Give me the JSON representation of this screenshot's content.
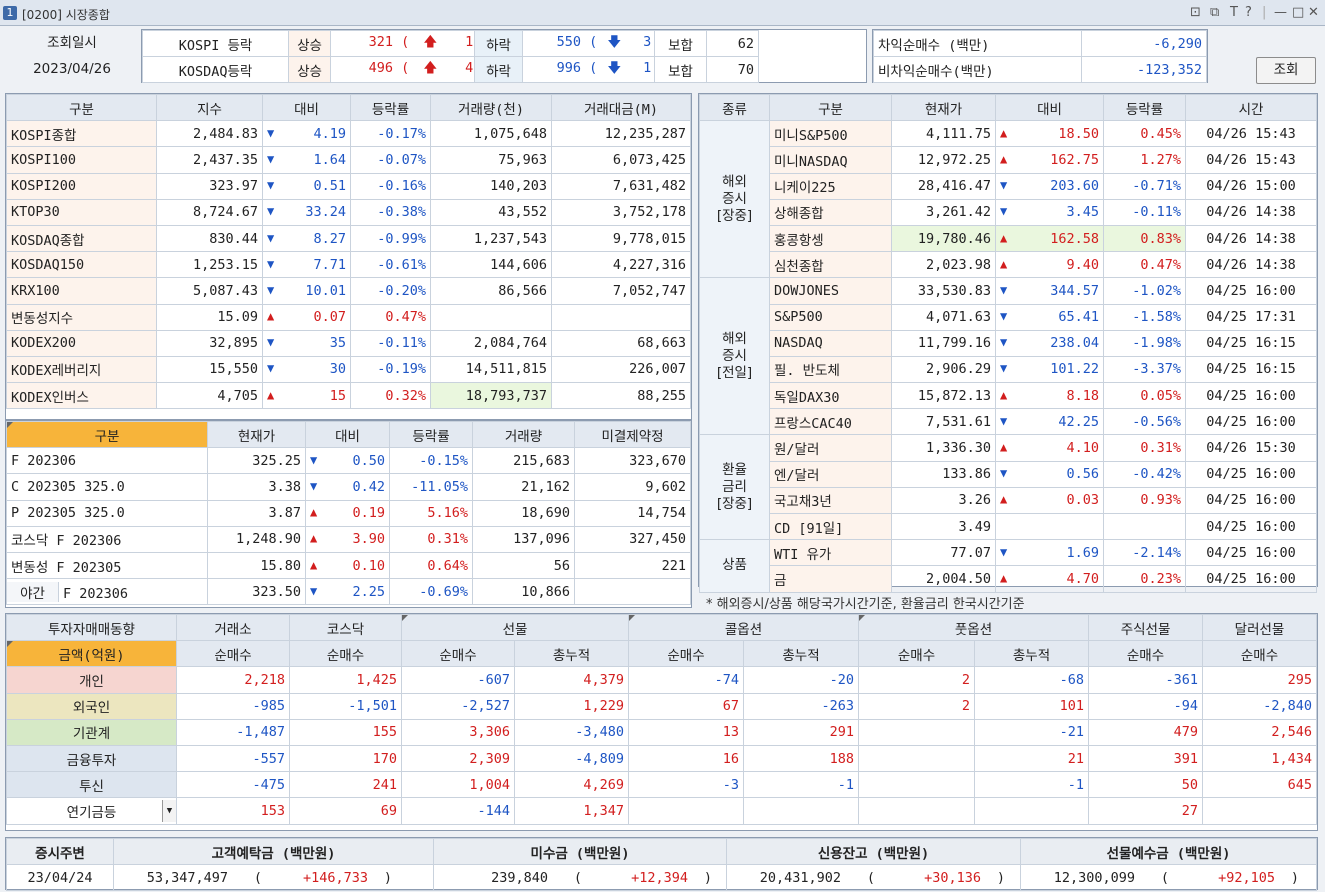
{
  "title": {
    "screen_num": "1",
    "text": "[0200] 시장종합",
    "icons": [
      "layout-icon",
      "window-icon",
      "text-icon",
      "help-icon",
      "minimize-icon",
      "maximize-icon",
      "close-icon"
    ]
  },
  "summary": {
    "query_label": "조회일시",
    "query_date": "2023/04/26",
    "rows": [
      {
        "name": "KOSPI 등락",
        "up_label": "상승",
        "up": "321",
        "up_limit": "1",
        "down_label": "하락",
        "down": "550",
        "down_limit": "3",
        "flat_label": "보합",
        "flat": "62"
      },
      {
        "name": "KOSDAQ등락",
        "up_label": "상승",
        "up": "496",
        "up_limit": "4",
        "down_label": "하락",
        "down": "996",
        "down_limit": "1",
        "flat_label": "보합",
        "flat": "70"
      }
    ],
    "program": [
      {
        "label": "차익순매수  (백만)",
        "value": "-6,290"
      },
      {
        "label": "비차익순매수(백만)",
        "value": "-123,352"
      }
    ],
    "button": "조회"
  },
  "index_table": {
    "headers": [
      "구분",
      "지수",
      "대비",
      "등락률",
      "거래량(천)",
      "거래대금(M)"
    ],
    "rows": [
      [
        "KOSPI종합",
        "2,484.83",
        "dn",
        "4.19",
        "-0.17%",
        "1,075,648",
        "12,235,287"
      ],
      [
        "KOSPI100",
        "2,437.35",
        "dn",
        "1.64",
        "-0.07%",
        "75,963",
        "6,073,425"
      ],
      [
        "KOSPI200",
        "323.97",
        "dn",
        "0.51",
        "-0.16%",
        "140,203",
        "7,631,482"
      ],
      [
        "KTOP30",
        "8,724.67",
        "dn",
        "33.24",
        "-0.38%",
        "43,552",
        "3,752,178"
      ],
      [
        "KOSDAQ종합",
        "830.44",
        "dn",
        "8.27",
        "-0.99%",
        "1,237,543",
        "9,778,015"
      ],
      [
        "KOSDAQ150",
        "1,253.15",
        "dn",
        "7.71",
        "-0.61%",
        "144,606",
        "4,227,316"
      ],
      [
        "KRX100",
        "5,087.43",
        "dn",
        "10.01",
        "-0.20%",
        "86,566",
        "7,052,747"
      ],
      [
        "변동성지수",
        "15.09",
        "up",
        "0.07",
        "0.47%",
        "",
        ""
      ],
      [
        "KODEX200",
        "32,895",
        "dn",
        "35",
        "-0.11%",
        "2,084,764",
        "68,663"
      ],
      [
        "KODEX레버리지",
        "15,550",
        "dn",
        "30",
        "-0.19%",
        "14,511,815",
        "226,007"
      ],
      [
        "KODEX인버스",
        "4,705",
        "up",
        "15",
        "0.32%",
        "18,793,737",
        "88,255"
      ]
    ]
  },
  "futures_table": {
    "headers": [
      "구분",
      "현재가",
      "대비",
      "등락률",
      "거래량",
      "미결제약정"
    ],
    "rows": [
      [
        "F 202306",
        "325.25",
        "dn",
        "0.50",
        "-0.15%",
        "215,683",
        "323,670"
      ],
      [
        "C 202305 325.0",
        "3.38",
        "dn",
        "0.42",
        "-11.05%",
        "21,162",
        "9,602"
      ],
      [
        "P 202305 325.0",
        "3.87",
        "up",
        "0.19",
        "5.16%",
        "18,690",
        "14,754"
      ],
      [
        "코스닥 F 202306",
        "1,248.90",
        "up",
        "3.90",
        "0.31%",
        "137,096",
        "327,450"
      ],
      [
        "변동성 F 202305",
        "15.80",
        "up",
        "0.10",
        "0.64%",
        "56",
        "221"
      ]
    ],
    "night": {
      "label": "야간",
      "name": "F 202306",
      "price": "323.50",
      "dir": "dn",
      "chg": "2.25",
      "rate": "-0.69%",
      "vol": "10,866",
      "oi": ""
    }
  },
  "world_table": {
    "headers": [
      "종류",
      "구분",
      "현재가",
      "대비",
      "등락률",
      "시간"
    ],
    "groups": [
      {
        "label": "해외\n증시\n[장중]",
        "rows": [
          [
            "미니S&P500",
            "4,111.75",
            "up",
            "18.50",
            "0.45%",
            "04/26 15:43"
          ],
          [
            "미니NASDAQ",
            "12,972.25",
            "up",
            "162.75",
            "1.27%",
            "04/26 15:43"
          ],
          [
            "니케이225",
            "28,416.47",
            "dn",
            "203.60",
            "-0.71%",
            "04/26 15:00"
          ],
          [
            "상해종합",
            "3,261.42",
            "dn",
            "3.45",
            "-0.11%",
            "04/26 14:38"
          ],
          [
            "홍콩항셍",
            "19,780.46",
            "up",
            "162.58",
            "0.83%",
            "04/26 14:38"
          ],
          [
            "심천종합",
            "2,023.98",
            "up",
            "9.40",
            "0.47%",
            "04/26 14:38"
          ]
        ]
      },
      {
        "label": "해외\n증시\n[전일]",
        "rows": [
          [
            "DOWJONES",
            "33,530.83",
            "dn",
            "344.57",
            "-1.02%",
            "04/25 16:00"
          ],
          [
            "S&P500",
            "4,071.63",
            "dn",
            "65.41",
            "-1.58%",
            "04/25 17:31"
          ],
          [
            "NASDAQ",
            "11,799.16",
            "dn",
            "238.04",
            "-1.98%",
            "04/25 16:15"
          ],
          [
            "필. 반도체",
            "2,906.29",
            "dn",
            "101.22",
            "-3.37%",
            "04/25 16:15"
          ],
          [
            "독일DAX30",
            "15,872.13",
            "up",
            "8.18",
            "0.05%",
            "04/25 16:00"
          ],
          [
            "프랑스CAC40",
            "7,531.61",
            "dn",
            "42.25",
            "-0.56%",
            "04/25 16:00"
          ]
        ]
      },
      {
        "label": "환율\n금리\n[장중]",
        "rows": [
          [
            "원/달러",
            "1,336.30",
            "up",
            "4.10",
            "0.31%",
            "04/26 15:30"
          ],
          [
            "엔/달러",
            "133.86",
            "dn",
            "0.56",
            "-0.42%",
            "04/25 16:00"
          ],
          [
            "국고채3년",
            "3.26",
            "up",
            "0.03",
            "0.93%",
            "04/25 16:00"
          ],
          [
            "CD [91일]",
            "3.49",
            "",
            "",
            "",
            "04/25 16:00"
          ]
        ]
      },
      {
        "label": "상품",
        "rows": [
          [
            "WTI 유가",
            "77.07",
            "dn",
            "1.69",
            "-2.14%",
            "04/25 16:00"
          ],
          [
            "금",
            "2,004.50",
            "up",
            "4.70",
            "0.23%",
            "04/25 16:00"
          ]
        ]
      }
    ],
    "note": "* 해외증시/상품 해당국가시간기준, 환율금리 한국시간기준"
  },
  "investor_table": {
    "title": "투자자매매동향",
    "unit": "금액(억원)",
    "groups": [
      "거래소",
      "코스닥",
      "선물",
      "콜옵션",
      "풋옵션",
      "주식선물",
      "달러선물"
    ],
    "sub": [
      "순매수",
      "순매수",
      "순매수",
      "총누적",
      "순매수",
      "총누적",
      "순매수",
      "총누적",
      "순매수",
      "순매수"
    ],
    "rows": [
      {
        "name": "개인",
        "vals": [
          "2,218",
          "1,425",
          "-607",
          "4,379",
          "-74",
          "-20",
          "2",
          "-68",
          "-361",
          "295"
        ]
      },
      {
        "name": "외국인",
        "vals": [
          "-985",
          "-1,501",
          "-2,527",
          "1,229",
          "67",
          "-263",
          "2",
          "101",
          "-94",
          "-2,840"
        ]
      },
      {
        "name": "기관계",
        "vals": [
          "-1,487",
          "155",
          "3,306",
          "-3,480",
          "13",
          "291",
          "",
          "-21",
          "479",
          "2,546"
        ]
      },
      {
        "name": "금융투자",
        "vals": [
          "-557",
          "170",
          "2,309",
          "-4,809",
          "16",
          "188",
          "",
          "21",
          "391",
          "1,434"
        ]
      },
      {
        "name": "투신",
        "vals": [
          "-475",
          "241",
          "1,004",
          "4,269",
          "-3",
          "-1",
          "",
          "-1",
          "50",
          "645"
        ]
      },
      {
        "name": "연기금등",
        "vals": [
          "153",
          "69",
          "-144",
          "1,347",
          "",
          "",
          "",
          "",
          "27",
          ""
        ]
      }
    ]
  },
  "funds": {
    "headers": [
      "증시주변",
      "고객예탁금 (백만원)",
      "미수금 (백만원)",
      "신용잔고 (백만원)",
      "선물예수금 (백만원)"
    ],
    "date": "23/04/24",
    "items": [
      {
        "v": "53,347,497",
        "d": "+146,733"
      },
      {
        "v": "239,840",
        "d": "+12,394"
      },
      {
        "v": "20,431,902",
        "d": "+30,136"
      },
      {
        "v": "12,300,099",
        "d": "+92,105"
      }
    ]
  }
}
